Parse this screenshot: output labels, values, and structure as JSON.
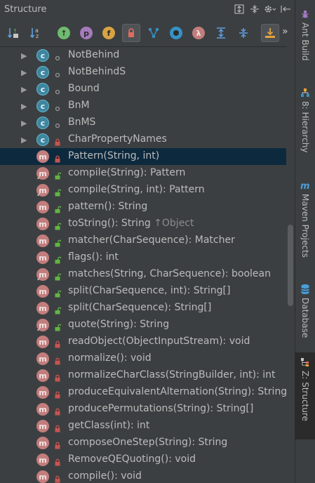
{
  "panel": {
    "title": "Structure",
    "toolbar_more": "»"
  },
  "toolbar": {
    "visibility_private_active": true
  },
  "tree": [
    {
      "kind": "class",
      "expand": "▶",
      "mod": "pkg",
      "label": "NotBehind",
      "hint": ""
    },
    {
      "kind": "class",
      "expand": "▶",
      "mod": "pkg",
      "label": "NotBehindS",
      "hint": ""
    },
    {
      "kind": "class",
      "expand": "▶",
      "mod": "pkg",
      "label": "Bound",
      "hint": ""
    },
    {
      "kind": "class",
      "expand": "▶",
      "mod": "pkg",
      "label": "BnM",
      "hint": ""
    },
    {
      "kind": "class",
      "expand": "▶",
      "mod": "pkg",
      "label": "BnMS",
      "hint": ""
    },
    {
      "kind": "class",
      "expand": "▶",
      "mod": "private",
      "label": "CharPropertyNames",
      "hint": ""
    },
    {
      "kind": "method",
      "expand": "",
      "mod": "private",
      "label": "Pattern(String, int)",
      "hint": "",
      "selected": true
    },
    {
      "kind": "method",
      "expand": "",
      "mod": "public",
      "label": "compile(String): Pattern",
      "hint": "",
      "static": true
    },
    {
      "kind": "method",
      "expand": "",
      "mod": "public",
      "label": "compile(String, int): Pattern",
      "hint": "",
      "static": true
    },
    {
      "kind": "method",
      "expand": "",
      "mod": "public",
      "label": "pattern(): String",
      "hint": ""
    },
    {
      "kind": "method",
      "expand": "",
      "mod": "public",
      "label": "toString(): String ",
      "hint": "↑Object"
    },
    {
      "kind": "method",
      "expand": "",
      "mod": "public",
      "label": "matcher(CharSequence): Matcher",
      "hint": ""
    },
    {
      "kind": "method",
      "expand": "",
      "mod": "public",
      "label": "flags(): int",
      "hint": ""
    },
    {
      "kind": "method",
      "expand": "",
      "mod": "public",
      "label": "matches(String, CharSequence): boolean",
      "hint": "",
      "static": true
    },
    {
      "kind": "method",
      "expand": "",
      "mod": "public",
      "label": "split(CharSequence, int): String[]",
      "hint": ""
    },
    {
      "kind": "method",
      "expand": "",
      "mod": "public",
      "label": "split(CharSequence): String[]",
      "hint": ""
    },
    {
      "kind": "method",
      "expand": "",
      "mod": "public",
      "label": "quote(String): String",
      "hint": "",
      "static": true
    },
    {
      "kind": "method",
      "expand": "",
      "mod": "private",
      "label": "readObject(ObjectInputStream): void",
      "hint": ""
    },
    {
      "kind": "method",
      "expand": "",
      "mod": "private",
      "label": "normalize(): void",
      "hint": ""
    },
    {
      "kind": "method",
      "expand": "",
      "mod": "private",
      "label": "normalizeCharClass(StringBuilder, int): int",
      "hint": ""
    },
    {
      "kind": "method",
      "expand": "",
      "mod": "private",
      "label": "produceEquivalentAlternation(String): String",
      "hint": ""
    },
    {
      "kind": "method",
      "expand": "",
      "mod": "private",
      "label": "producePermutations(String): String[]",
      "hint": ""
    },
    {
      "kind": "method",
      "expand": "",
      "mod": "private",
      "label": "getClass(int): int",
      "hint": ""
    },
    {
      "kind": "method",
      "expand": "",
      "mod": "private",
      "label": "composeOneStep(String): String",
      "hint": ""
    },
    {
      "kind": "method",
      "expand": "",
      "mod": "private",
      "label": "RemoveQEQuoting(): void",
      "hint": ""
    },
    {
      "kind": "method",
      "expand": "",
      "mod": "private",
      "label": "compile(): void",
      "hint": ""
    }
  ],
  "sidebar": {
    "tabs": [
      {
        "label": "Ant Build",
        "icon": "ant-icon",
        "active": false
      },
      {
        "label": "8: Hierarchy",
        "icon": "hierarchy-icon",
        "active": false
      },
      {
        "label": "Maven Projects",
        "icon": "maven-icon",
        "active": false
      },
      {
        "label": "Database",
        "icon": "database-icon",
        "active": false
      },
      {
        "label": "Z: Structure",
        "icon": "structure-icon",
        "active": true
      }
    ]
  },
  "colors": {
    "background": "#3c3f41",
    "selection": "#0d293e",
    "class_icon": "#3e86a0",
    "method_icon": "#c27d7d",
    "lock_public": "#62b543",
    "lock_private": "#c75450"
  }
}
